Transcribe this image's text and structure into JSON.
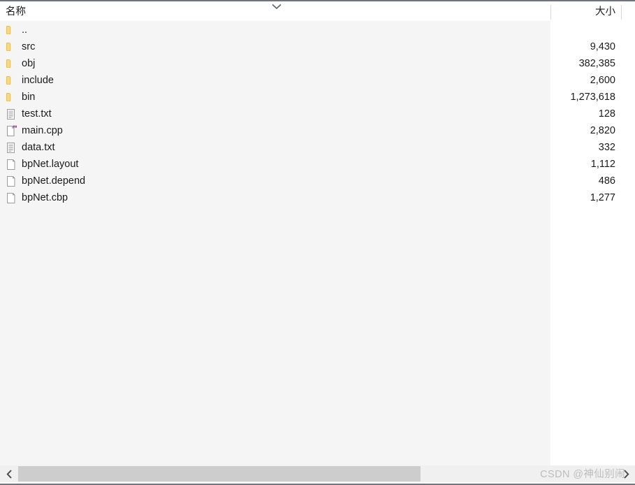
{
  "window": {
    "title": "File listing pane",
    "background": "#f5f5f5",
    "header_background": "#ffffff",
    "border_color": "#6f747f"
  },
  "columns": {
    "name_label": "名称",
    "size_label": "大小",
    "sort_indicator": "chevron-down-icon"
  },
  "files": [
    {
      "name": "..",
      "size": "",
      "icon": "folder-icon"
    },
    {
      "name": "src",
      "size": "9,430",
      "icon": "folder-icon"
    },
    {
      "name": "obj",
      "size": "382,385",
      "icon": "folder-icon"
    },
    {
      "name": "include",
      "size": "2,600",
      "icon": "folder-icon"
    },
    {
      "name": "bin",
      "size": "1,273,618",
      "icon": "folder-icon"
    },
    {
      "name": "test.txt",
      "size": "128",
      "icon": "text-file-icon"
    },
    {
      "name": "main.cpp",
      "size": "2,820",
      "icon": "cpp-file-icon"
    },
    {
      "name": "data.txt",
      "size": "332",
      "icon": "text-file-icon"
    },
    {
      "name": "bpNet.layout",
      "size": "1,112",
      "icon": "blank-file-icon"
    },
    {
      "name": "bpNet.depend",
      "size": "486",
      "icon": "blank-file-icon"
    },
    {
      "name": "bpNet.cbp",
      "size": "1,277",
      "icon": "blank-file-icon"
    }
  ],
  "scrollbar": {
    "left_button": "chevron-left-icon",
    "right_button": "chevron-right-icon",
    "thumb_color": "#cdcdcd",
    "track_color": "#f0f0f0"
  },
  "watermark": {
    "text": "CSDN @神仙别闹",
    "color": "#bdbdbd"
  },
  "icon_colors": {
    "folder": "#fcd77f",
    "folder_edge": "#e8b930",
    "file_outline": "#9a9a9a",
    "cpp_accent": "#9b4f96"
  }
}
